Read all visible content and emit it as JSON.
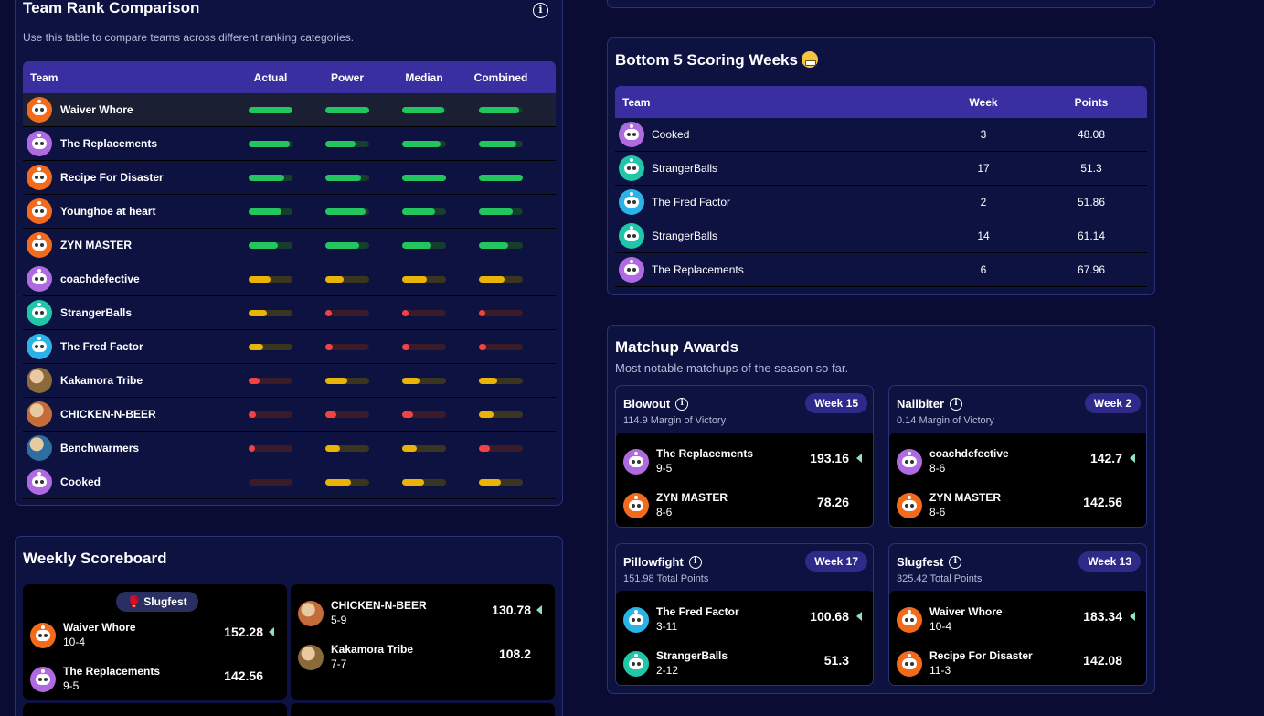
{
  "colors": {
    "green": "#22c55e",
    "green_track": "#163d2e",
    "yellow": "#eab308",
    "yellow_track": "#3a3520",
    "red": "#ef4444",
    "red_track": "#3b1a2a"
  },
  "rank": {
    "title": "Team Rank Comparison",
    "subtitle": "Use this table to compare teams across different ranking categories.",
    "info_icon": "info-icon",
    "columns": [
      "Team",
      "Actual",
      "Power",
      "Median",
      "Combined"
    ],
    "rows": [
      {
        "team": "Waiver Whore",
        "avatar": "#f26b1d",
        "bars": [
          [
            "green",
            1.0
          ],
          [
            "green",
            1.0
          ],
          [
            "green",
            0.95
          ],
          [
            "green",
            0.92
          ]
        ],
        "highlight": true
      },
      {
        "team": "The Replacements",
        "avatar": "#b06ae0",
        "bars": [
          [
            "green",
            0.93
          ],
          [
            "green",
            0.68
          ],
          [
            "green",
            0.88
          ],
          [
            "green",
            0.86
          ]
        ]
      },
      {
        "team": "Recipe For Disaster",
        "avatar": "#f26b1d",
        "bars": [
          [
            "green",
            0.82
          ],
          [
            "green",
            0.82
          ],
          [
            "green",
            1.0
          ],
          [
            "green",
            1.0
          ]
        ]
      },
      {
        "team": "Younghoe at heart",
        "avatar": "#f26b1d",
        "bars": [
          [
            "green",
            0.74
          ],
          [
            "green",
            0.92
          ],
          [
            "green",
            0.75
          ],
          [
            "green",
            0.78
          ]
        ]
      },
      {
        "team": "ZYN MASTER",
        "avatar": "#f26b1d",
        "bars": [
          [
            "green",
            0.67
          ],
          [
            "green",
            0.78
          ],
          [
            "green",
            0.66
          ],
          [
            "green",
            0.66
          ]
        ]
      },
      {
        "team": "coachdefective",
        "avatar": "#b06ae0",
        "bars": [
          [
            "yellow",
            0.5
          ],
          [
            "yellow",
            0.42
          ],
          [
            "yellow",
            0.56
          ],
          [
            "yellow",
            0.58
          ]
        ]
      },
      {
        "team": "StrangerBalls",
        "avatar": "#1fc7a8",
        "bars": [
          [
            "yellow",
            0.42
          ],
          [
            "red",
            0.08
          ],
          [
            "red",
            0.08
          ],
          [
            "red",
            0.05
          ]
        ]
      },
      {
        "team": "The Fred Factor",
        "avatar": "#2bb3e8",
        "bars": [
          [
            "yellow",
            0.33
          ],
          [
            "red",
            0.16
          ],
          [
            "red",
            0.16
          ],
          [
            "red",
            0.16
          ]
        ]
      },
      {
        "team": "Kakamora Tribe",
        "avatar": "#8a6a3a",
        "photo": true,
        "bars": [
          [
            "red",
            0.24
          ],
          [
            "yellow",
            0.5
          ],
          [
            "yellow",
            0.4
          ],
          [
            "yellow",
            0.42
          ]
        ]
      },
      {
        "team": "CHICKEN-N-BEER",
        "avatar": "#c46c3a",
        "photo": true,
        "bars": [
          [
            "red",
            0.16
          ],
          [
            "red",
            0.24
          ],
          [
            "red",
            0.24
          ],
          [
            "yellow",
            0.34
          ]
        ]
      },
      {
        "team": "Benchwarmers",
        "avatar": "#2e6fa0",
        "photo": true,
        "bars": [
          [
            "red",
            0.08
          ],
          [
            "yellow",
            0.34
          ],
          [
            "yellow",
            0.34
          ],
          [
            "red",
            0.25
          ]
        ]
      },
      {
        "team": "Cooked",
        "avatar": "#b06ae0",
        "bars": [
          [
            "red",
            0.0
          ],
          [
            "yellow",
            0.58
          ],
          [
            "yellow",
            0.5
          ],
          [
            "yellow",
            0.5
          ]
        ]
      }
    ]
  },
  "scoreboard": {
    "title": "Weekly Scoreboard",
    "matchups": [
      {
        "pill": "🥊 Slugfest",
        "teams": [
          {
            "name": "Waiver Whore",
            "record": "10-4",
            "score": "152.28",
            "winner": true,
            "avatar": "#f26b1d"
          },
          {
            "name": "The Replacements",
            "record": "9-5",
            "score": "142.56",
            "winner": false,
            "avatar": "#b06ae0"
          }
        ]
      },
      {
        "pill": "",
        "teams": [
          {
            "name": "CHICKEN-N-BEER",
            "record": "5-9",
            "score": "130.78",
            "winner": true,
            "avatar": "#c46c3a",
            "photo": true
          },
          {
            "name": "Kakamora Tribe",
            "record": "7-7",
            "score": "108.2",
            "winner": false,
            "avatar": "#8a6a3a",
            "photo": true
          }
        ]
      }
    ]
  },
  "bottom5": {
    "title": "Bottom 5 Scoring Weeks",
    "columns": [
      "Team",
      "Week",
      "Points"
    ],
    "rows": [
      {
        "team": "Cooked",
        "week": "3",
        "points": "48.08",
        "avatar": "#b06ae0"
      },
      {
        "team": "StrangerBalls",
        "week": "17",
        "points": "51.3",
        "avatar": "#1fc7a8"
      },
      {
        "team": "The Fred Factor",
        "week": "2",
        "points": "51.86",
        "avatar": "#2bb3e8"
      },
      {
        "team": "StrangerBalls",
        "week": "14",
        "points": "61.14",
        "avatar": "#1fc7a8"
      },
      {
        "team": "The Replacements",
        "week": "6",
        "points": "67.96",
        "avatar": "#b06ae0"
      }
    ]
  },
  "awards": {
    "title": "Matchup Awards",
    "subtitle": "Most notable matchups of the season so far.",
    "items": [
      {
        "name": "Blowout",
        "desc": "114.9 Margin of Victory",
        "week": "Week 15",
        "teams": [
          {
            "name": "The Replacements",
            "record": "9-5",
            "score": "193.16",
            "winner": true,
            "avatar": "#b06ae0"
          },
          {
            "name": "ZYN MASTER",
            "record": "8-6",
            "score": "78.26",
            "winner": false,
            "avatar": "#f26b1d"
          }
        ]
      },
      {
        "name": "Nailbiter",
        "desc": "0.14 Margin of Victory",
        "week": "Week 2",
        "teams": [
          {
            "name": "coachdefective",
            "record": "8-6",
            "score": "142.7",
            "winner": true,
            "avatar": "#b06ae0"
          },
          {
            "name": "ZYN MASTER",
            "record": "8-6",
            "score": "142.56",
            "winner": false,
            "avatar": "#f26b1d"
          }
        ]
      },
      {
        "name": "Pillowfight",
        "desc": "151.98 Total Points",
        "week": "Week 17",
        "teams": [
          {
            "name": "The Fred Factor",
            "record": "3-11",
            "score": "100.68",
            "winner": true,
            "avatar": "#2bb3e8"
          },
          {
            "name": "StrangerBalls",
            "record": "2-12",
            "score": "51.3",
            "winner": false,
            "avatar": "#1fc7a8"
          }
        ]
      },
      {
        "name": "Slugfest",
        "desc": "325.42 Total Points",
        "week": "Week 13",
        "teams": [
          {
            "name": "Waiver Whore",
            "record": "10-4",
            "score": "183.34",
            "winner": true,
            "avatar": "#f26b1d"
          },
          {
            "name": "Recipe For Disaster",
            "record": "11-3",
            "score": "142.08",
            "winner": false,
            "avatar": "#f26b1d"
          }
        ]
      }
    ]
  }
}
